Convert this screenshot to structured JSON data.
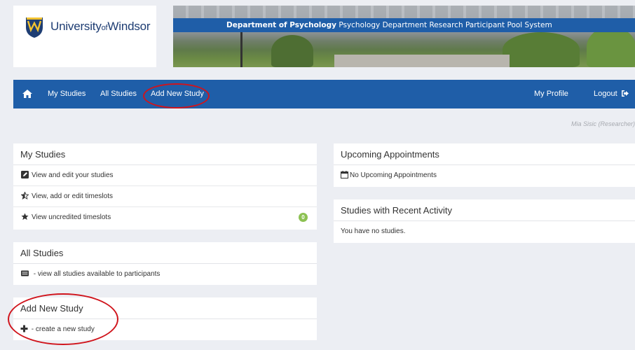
{
  "header": {
    "logo_main": "University",
    "logo_of": "of",
    "logo_end": "Windsor",
    "banner_bold": "Department of Psychology",
    "banner_rest": " Psychology Department Research Participant Pool System"
  },
  "nav": {
    "my_studies": "My Studies",
    "all_studies": "All Studies",
    "add_new_study": "Add New Study",
    "my_profile": "My Profile",
    "logout": "Logout"
  },
  "user_line": "Mia Sisic (Researcher)",
  "my_studies_panel": {
    "title": "My Studies",
    "view_edit": "View and edit your studies",
    "timeslots": "View, add or edit timeslots",
    "uncredited": "View uncredited timeslots",
    "uncredited_count": "0"
  },
  "all_studies_panel": {
    "title": "All Studies",
    "view_all": " - view all studies available to participants"
  },
  "add_study_panel": {
    "title": "Add New Study",
    "create": " - create a new study"
  },
  "appointments_panel": {
    "title": "Upcoming Appointments",
    "empty": "No Upcoming Appointments"
  },
  "recent_panel": {
    "title": "Studies with Recent Activity",
    "empty": "You have no studies."
  },
  "colors": {
    "nav_blue": "#1f5ea8",
    "annotation_red": "#d0141c",
    "badge_green": "#8cc152"
  }
}
